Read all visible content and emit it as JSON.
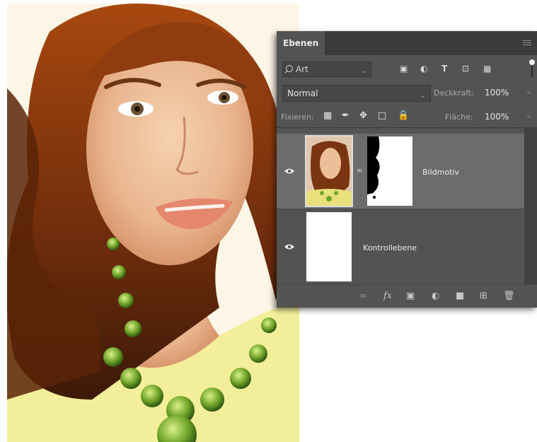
{
  "panel": {
    "tab_label": "Ebenen",
    "filter": {
      "value": "Art",
      "icons": [
        "image-filter-icon",
        "adjustment-filter-icon",
        "type-filter-icon",
        "shape-filter-icon",
        "smart-object-filter-icon"
      ]
    },
    "blend_mode": "Normal",
    "opacity_label": "Deckkraft:",
    "opacity_value": "100%",
    "lock_label": "Fixieren:",
    "lock_icons": [
      "lock-transparent-icon",
      "lock-image-icon",
      "lock-position-icon",
      "lock-artboard-icon",
      "lock-all-icon"
    ],
    "fill_label": "Fläche:",
    "fill_value": "100%",
    "layers": [
      {
        "name": "Bildmotiv",
        "visible": true,
        "selected": true,
        "has_mask": true
      },
      {
        "name": "Kontrollebene",
        "visible": true,
        "selected": false,
        "has_mask": false
      }
    ],
    "bottom_icons": [
      "link-layers-icon",
      "fx-icon",
      "add-mask-icon",
      "adjustment-layer-icon",
      "new-group-icon",
      "new-layer-icon",
      "delete-icon"
    ],
    "fx_label": "fx"
  },
  "colors": {
    "panel_bg": "#535353",
    "selected_layer": "#6c6c6c",
    "tab_bar": "#3b3b3b"
  }
}
